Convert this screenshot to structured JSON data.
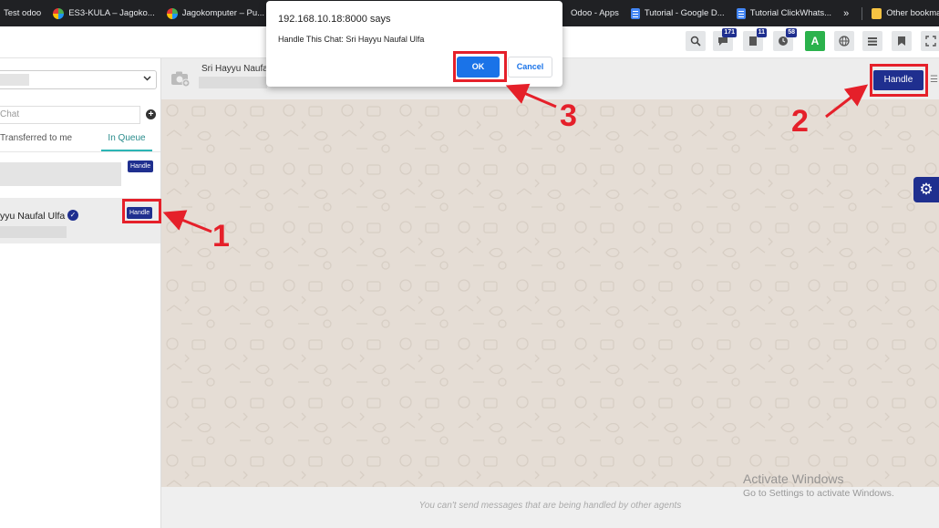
{
  "bookmarks": [
    {
      "label": "Test odoo",
      "icon": "none"
    },
    {
      "label": "ES3-KULA – Jagoko...",
      "icon": "globe-icon"
    },
    {
      "label": "Jagokomputer – Pu...",
      "icon": "globe-icon"
    },
    {
      "label": "",
      "icon": "globe-icon"
    },
    {
      "label": "Odoo - Apps",
      "icon": "none"
    },
    {
      "label": "Tutorial - Google D...",
      "icon": "doc-icon"
    },
    {
      "label": "Tutorial ClickWhats...",
      "icon": "doc-icon"
    }
  ],
  "bookmarks_more": "»",
  "other_bookmarks": "Other bookmarks",
  "header_buttons": {
    "messages_count": "171",
    "notes_count": "11",
    "activities_count": "58",
    "user_initial": "A"
  },
  "left_panel": {
    "search_placeholder": "Chat",
    "tabs": [
      "Transferred to me",
      "In Queue"
    ],
    "items": [
      {
        "name": "",
        "handle_label": "Handle"
      },
      {
        "name": "yyu Naufal Ulfa",
        "handle_label": "Handle"
      }
    ]
  },
  "chat": {
    "contact_name": "Sri Hayyu Naufa",
    "handle_label": "Handle",
    "footer_text": "You can't send messages that are being handled by other agents"
  },
  "dialog": {
    "title": "192.168.10.18:8000 says",
    "message": "Handle This Chat: Sri Hayyu Naufal Ulfa",
    "ok_label": "OK",
    "cancel_label": "Cancel"
  },
  "watermark": {
    "line1": "Activate Windows",
    "line2": "Go to Settings to activate Windows."
  },
  "annotations": {
    "step1": "1",
    "step2": "2",
    "step3": "3",
    "color": "#e5202a"
  },
  "colors": {
    "accent": "#1f2f8f",
    "chat_bg": "#e5ddd5",
    "dialog_ok": "#1a73e8"
  }
}
